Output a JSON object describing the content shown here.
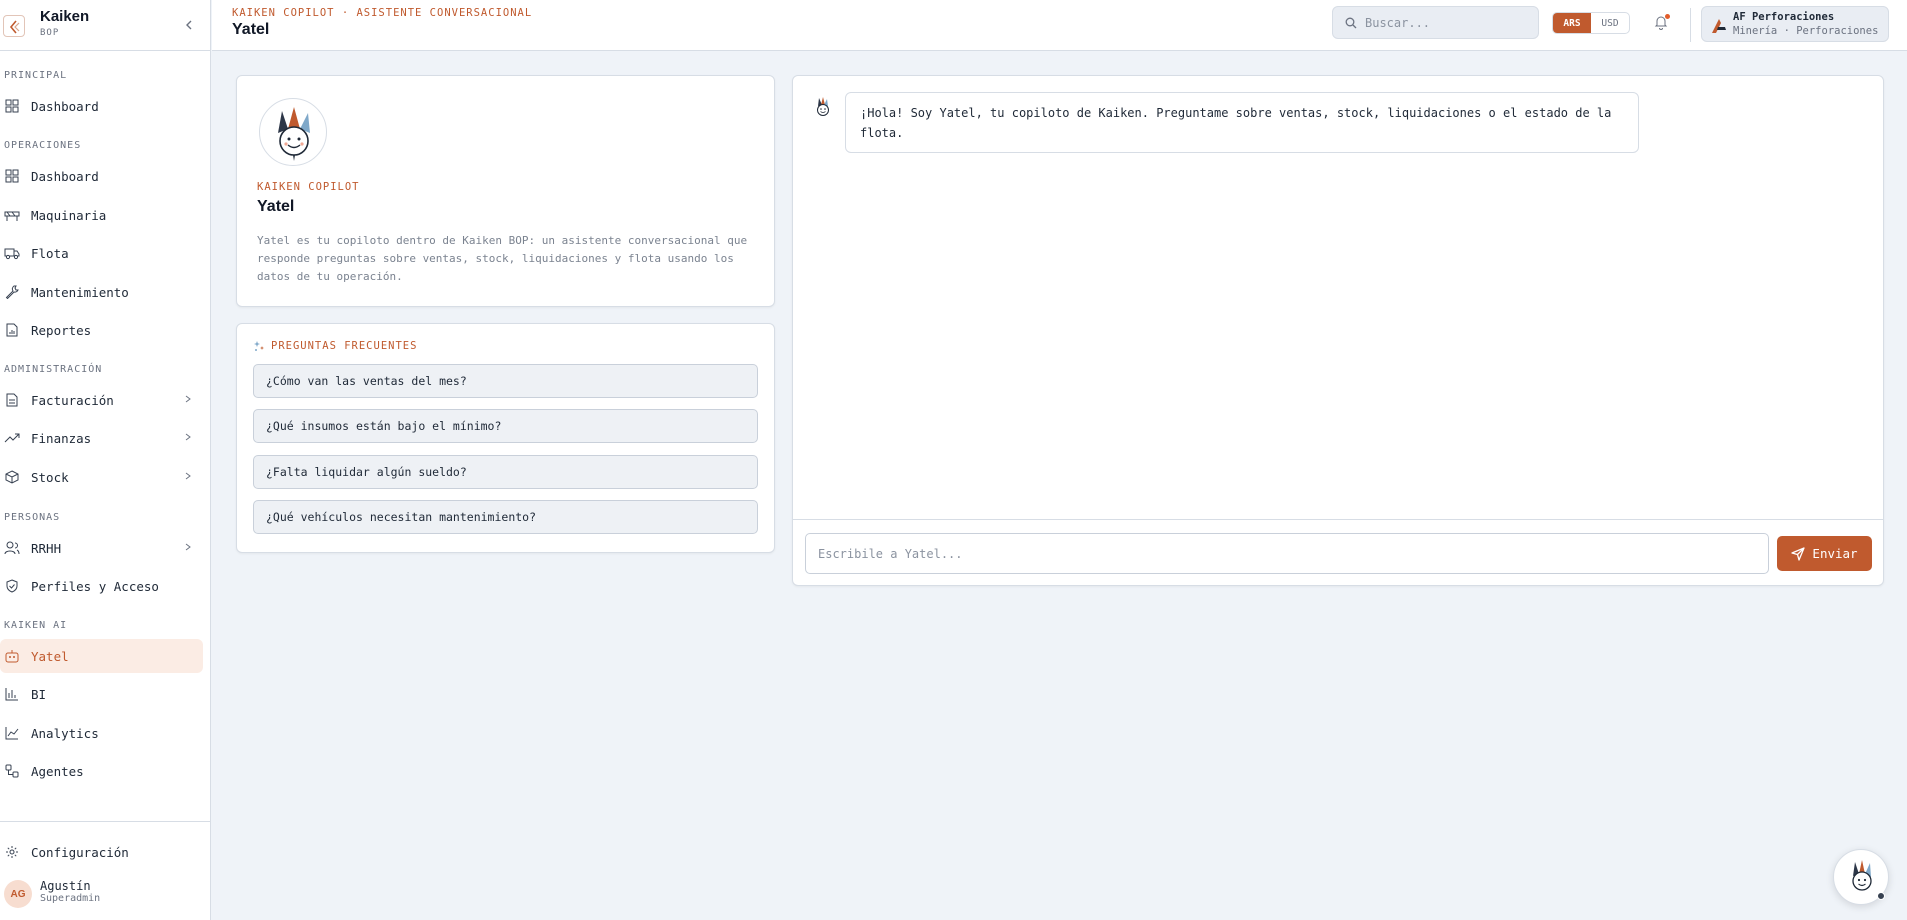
{
  "brand": {
    "name": "Kaiken",
    "sub": "BOP"
  },
  "sidebar": {
    "sections": {
      "principal": "PRINCIPAL",
      "operaciones": "OPERACIONES",
      "administracion": "ADMINISTRACIÓN",
      "personas": "PERSONAS",
      "kaiken_ai": "KAIKEN AI"
    },
    "items": {
      "dashboard_principal": "Dashboard",
      "dashboard_ops": "Dashboard",
      "maquinaria": "Maquinaria",
      "flota": "Flota",
      "mantenimiento": "Mantenimiento",
      "reportes": "Reportes",
      "facturacion": "Facturación",
      "finanzas": "Finanzas",
      "stock": "Stock",
      "rrhh": "RRHH",
      "perfiles": "Perfiles y Acceso",
      "yatel": "Yatel",
      "bi": "BI",
      "analytics": "Analytics",
      "agentes": "Agentes"
    },
    "footer": {
      "configuracion": "Configuración",
      "user_initials": "AG",
      "user_name": "Agustín",
      "user_role": "Superadmin"
    }
  },
  "header": {
    "breadcrumb": "KAIKEN COPILOT · ASISTENTE CONVERSACIONAL",
    "title": "Yatel",
    "search_placeholder": "Buscar...",
    "currency": {
      "ars": "ARS",
      "usd": "USD",
      "selected": "ARS"
    },
    "company": {
      "name": "AF Perforaciones",
      "sub": "Minería · Perforaciones"
    }
  },
  "profile": {
    "eyebrow": "KAIKEN COPILOT",
    "name": "Yatel",
    "description": "Yatel es tu copiloto dentro de Kaiken BOP: un asistente conversacional que responde preguntas sobre ventas, stock, liquidaciones y flota usando los datos de tu operación."
  },
  "faq": {
    "title": "PREGUNTAS FRECUENTES",
    "questions": [
      "¿Cómo van las ventas del mes?",
      "¿Qué insumos están bajo el mínimo?",
      "¿Falta liquidar algún sueldo?",
      "¿Qué vehículos necesitan mantenimiento?"
    ]
  },
  "chat": {
    "greeting": "¡Hola! Soy Yatel, tu copiloto de Kaiken. Preguntame sobre ventas, stock, liquidaciones o el estado de la flota.",
    "input_placeholder": "Escribile a Yatel...",
    "send_label": "Enviar"
  },
  "colors": {
    "accent": "#c05a2e",
    "accent_light": "#fbece4",
    "background": "#eff3f8"
  },
  "icons": {
    "brand": "kaiken-logo-icon",
    "collapse": "chevron-left-icon",
    "search": "search-icon",
    "bell": "bell-icon",
    "send": "send-icon",
    "faq": "sparkles-icon",
    "bot": "yatel-bot-icon"
  }
}
